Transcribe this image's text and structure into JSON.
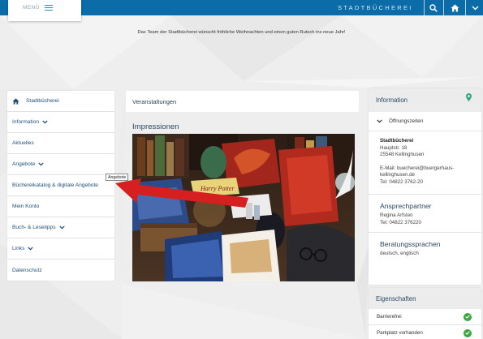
{
  "header": {
    "menu_label": "MENÜ",
    "brand": "STADTBÜCHEREI",
    "xmas_message": "Das Team der Stadtbücherei wünscht fröhliche Weihnachten und einen guten Rutsch ins neue Jahr!",
    "colors": {
      "bar": "#0b6ca8"
    }
  },
  "sidebar": {
    "items": [
      {
        "label": "Stadtbücherei",
        "icon": "home-icon"
      },
      {
        "label": "Information",
        "icon": "chevron-down-icon"
      },
      {
        "label": "Aktuelles"
      },
      {
        "label": "Angebote",
        "icon": "chevron-down-icon"
      },
      {
        "label": "Büchereikatalog & digitale Angebote"
      },
      {
        "label": "Mein Konto"
      },
      {
        "label": "Buch- & Lesetipps",
        "icon": "chevron-down-icon"
      },
      {
        "label": "Links",
        "icon": "chevron-down-icon"
      },
      {
        "label": "Datenschutz"
      }
    ],
    "tooltip": "Angebote"
  },
  "main": {
    "events_title": "Veranstaltungen",
    "impressions_title": "Impressionen",
    "photo_book_title": "Harry Potter"
  },
  "info": {
    "title": "Information",
    "hours_label": "Öffnungszeiten",
    "address": {
      "name": "Stadtbücherei",
      "street": "Hauptstr. 18",
      "city": "25548 Kellinghusen",
      "email_1": "E-Mail: buecherei@buergerhaus-",
      "email_2": "kellinghusen.de",
      "phone": "Tel: 04822 3762-20"
    },
    "contact": {
      "title": "Ansprechpartner",
      "name": "Regina Arfsten",
      "phone": "Tel: 04822 376220"
    },
    "languages": {
      "title": "Beratungssprachen",
      "value": "deutsch, englisch"
    }
  },
  "properties": {
    "title": "Eigenschaften",
    "items": [
      {
        "label": "Barrierefrei",
        "icon": "check-circle-icon"
      },
      {
        "label": "Parkplatz vorhanden",
        "icon": "check-circle-icon"
      }
    ],
    "colors": {
      "check": "#36a93a"
    }
  }
}
